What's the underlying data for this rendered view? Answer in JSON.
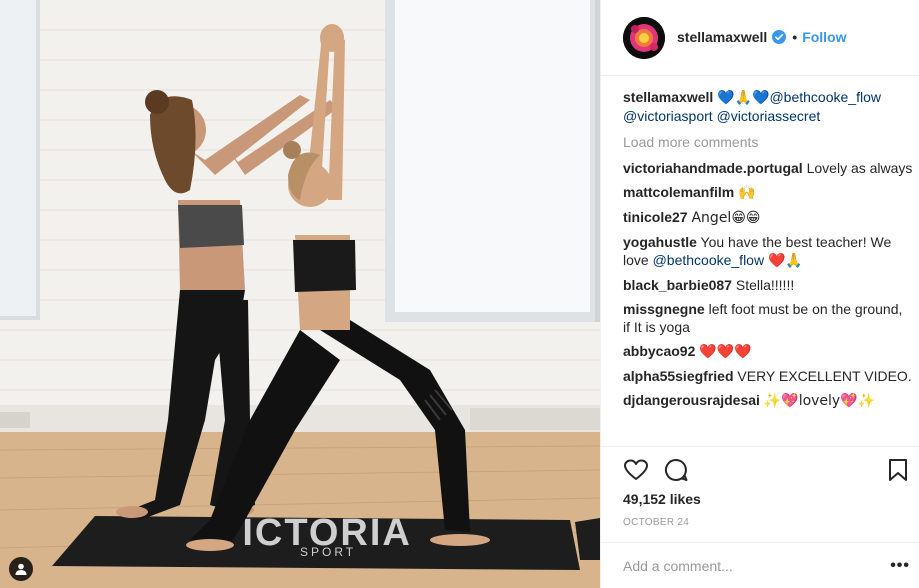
{
  "post": {
    "username": "stellamaxwell",
    "verified": true,
    "follow_label": "Follow",
    "separator": "•"
  },
  "photo": {
    "mat_brand": "VICTORIA",
    "mat_sub": "SPORT",
    "user_tag_icon": "user-silhouette-icon"
  },
  "caption": {
    "username": "stellamaxwell",
    "emoji": "💙🙏💙",
    "mention1": "@bethcooke_flow",
    "mention2": "@victoriasport",
    "mention3": "@victoriassecret"
  },
  "load_more": "Load more comments",
  "comments": [
    {
      "user": "victoriahandmade.portugal",
      "text": "Lovely as always"
    },
    {
      "user": "mattcolemanfilm",
      "text": "🙌"
    },
    {
      "user": "tinicole27",
      "text": "Angel😁😁"
    },
    {
      "user": "yogahustle",
      "text": "You have the best teacher! We love",
      "mention": "@bethcooke_flow",
      "tail": "❤️🙏"
    },
    {
      "user": "black_barbie087",
      "text": "Stella!!!!!!"
    },
    {
      "user": "missgnegne",
      "text": "left foot must be on the ground, if It is yoga"
    },
    {
      "user": "abbycao92",
      "text": "❤️❤️❤️"
    },
    {
      "user": "alpha55siegfried",
      "text": "VERY EXCELLENT VIDEO."
    },
    {
      "user": "djdangerousrajdesai",
      "text": "✨💖lovely💖✨"
    }
  ],
  "actions": {
    "like_icon": "heart-icon",
    "comment_icon": "comment-bubble-icon",
    "save_icon": "bookmark-icon"
  },
  "likes": "49,152 likes",
  "date": "OCTOBER 24",
  "add_comment": {
    "placeholder": "Add a comment...",
    "more_label": "•••"
  },
  "colors": {
    "link": "#3897f0",
    "mention": "#003569",
    "muted": "#999999",
    "text": "#262626",
    "verified": "#3897f0"
  }
}
